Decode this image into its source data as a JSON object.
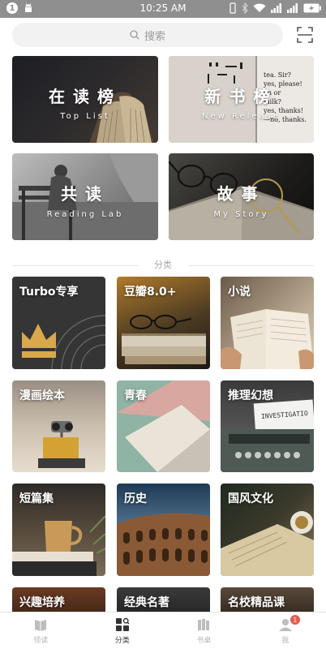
{
  "status_bar": {
    "time": "10:25 AM",
    "notification_count": "1"
  },
  "search": {
    "placeholder": "搜索"
  },
  "featured": [
    {
      "title": "在读榜",
      "subtitle": "Top List"
    },
    {
      "title": "新书榜",
      "subtitle": "New Release"
    },
    {
      "title": "共读",
      "subtitle": "Reading Lab"
    },
    {
      "title": "故事",
      "subtitle": "My Story"
    }
  ],
  "section": {
    "label": "分类"
  },
  "categories": [
    {
      "label": "Turbo专享"
    },
    {
      "label": "豆瓣8.0+"
    },
    {
      "label": "小说"
    },
    {
      "label": "漫画绘本"
    },
    {
      "label": "青春"
    },
    {
      "label": "推理幻想"
    },
    {
      "label": "短篇集"
    },
    {
      "label": "历史"
    },
    {
      "label": "国风文化"
    },
    {
      "label": "兴趣培养"
    },
    {
      "label": "经典名著"
    },
    {
      "label": "名校精品课"
    }
  ],
  "book_text": {
    "new_release": [
      "tea. Sir?",
      "yes, please!",
      "on or",
      "milk?",
      "yes, thanks!",
      "—no, thanks."
    ],
    "investigation": "INVESTIGATIO"
  },
  "tabbar": {
    "tabs": [
      {
        "label": "领读",
        "icon": "book-icon"
      },
      {
        "label": "分类",
        "icon": "grid-icon"
      },
      {
        "label": "书桌",
        "icon": "books-icon"
      },
      {
        "label": "我",
        "icon": "profile-icon"
      }
    ],
    "active_index": 1,
    "profile_badge": "1"
  },
  "colors": {
    "accent_badge": "#e65a50",
    "status_bar": "#8f8f8f",
    "search_bg": "#f2f2f2"
  }
}
